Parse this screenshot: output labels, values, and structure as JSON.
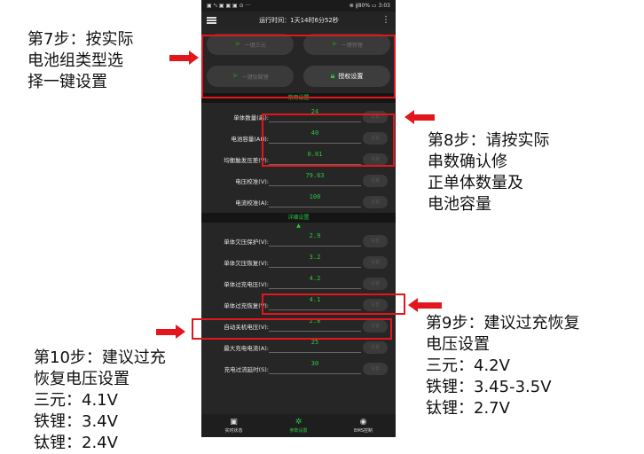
{
  "annotations": {
    "step7": "第7步：按实际\n电池组类型选\n择一键设置",
    "step8": "第8步：请按实际\n串数确认修\n正单体数量及\n电池容量",
    "step9": "第9步：建议过充恢复\n电压设置\n三元：4.2V\n铁锂：3.45-3.5V\n钛锂：2.7V",
    "step10": "第10步：建议过充\n恢复电压设置\n三元：4.1V\n铁锂：3.4V\n钛锂：2.4V"
  },
  "status_bar": {
    "left": "▣ ᵃᵢₗ ▣ ▣ ▣ ⊙ ···",
    "right": "⊗ ∦80% ▭ 3:03"
  },
  "app_bar": {
    "runtime": "运行时间：1天14时6分52秒"
  },
  "quick_buttons": [
    {
      "label": "一键三元"
    },
    {
      "label": "一键铁锂"
    },
    {
      "label": "一键钛酸锂"
    },
    {
      "label": "授权设置"
    }
  ],
  "common_settings": {
    "title": "常用设置",
    "rows": [
      {
        "label": "单体数量(串):",
        "value": "24",
        "button": "设置"
      },
      {
        "label": "电池容量(AH):",
        "value": "40",
        "button": "设置"
      },
      {
        "label": "均衡触发压差(V):",
        "value": "0.01",
        "button": "设置"
      },
      {
        "label": "电压校准(V):",
        "value": "79.63",
        "button": "设置"
      },
      {
        "label": "电流校准(A):",
        "value": "100",
        "button": "设置"
      }
    ]
  },
  "detail_settings": {
    "title": "详细设置",
    "rows": [
      {
        "label": "单体欠压保护(V):",
        "value": "2.9",
        "button": "设置"
      },
      {
        "label": "单体欠压恢复(V):",
        "value": "3.2",
        "button": "设置"
      },
      {
        "label": "单体过充电压(V):",
        "value": "4.2",
        "button": "设置"
      },
      {
        "label": "单体过充恢复(V):",
        "value": "4.1",
        "button": "设置"
      },
      {
        "label": "自动关机电压(V):",
        "value": "2.8",
        "button": "设置"
      },
      {
        "label": "最大充电电流(A):",
        "value": "25",
        "button": "设置"
      },
      {
        "label": "充电过流延时(S):",
        "value": "30",
        "button": "设置"
      }
    ]
  },
  "bottom_nav": [
    {
      "label": "实时状态",
      "icon": "monitor-icon"
    },
    {
      "label": "参数设置",
      "icon": "gear-icon"
    },
    {
      "label": "BMS控制",
      "icon": "toggle-icon"
    }
  ],
  "colors": {
    "accent": "#27c93f",
    "highlight": "#e4161d",
    "background": "#262626"
  }
}
